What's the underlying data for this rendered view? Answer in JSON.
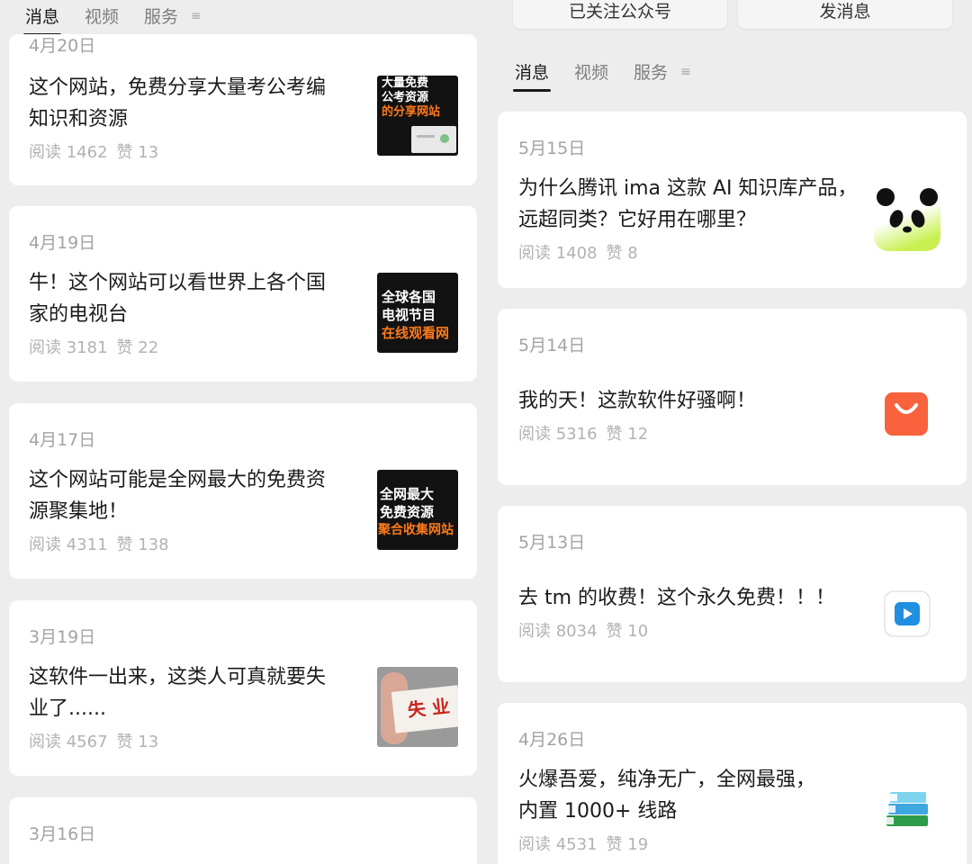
{
  "left": {
    "tabs": [
      {
        "label": "消息"
      },
      {
        "label": "视频"
      },
      {
        "label": "服务"
      }
    ],
    "tab_menu_symbol": "≡",
    "articles": [
      {
        "date": "4月20日",
        "title_lines": [
          "这个网站，免费分享大量考公考编",
          "知识和资源"
        ],
        "reads": "阅读 1462",
        "likes": "赞 13",
        "thumb_lines": [
          "大量免费",
          "公考资源",
          "的分享网站"
        ]
      },
      {
        "date": "4月19日",
        "title_lines": [
          "牛！这个网站可以看世界上各个国",
          "家的电视台"
        ],
        "reads": "阅读 3181",
        "likes": "赞 22",
        "thumb_lines": [
          "全球各国",
          "电视节目",
          "在线观看网"
        ]
      },
      {
        "date": "4月17日",
        "title_lines": [
          "这个网站可能是全网最大的免费资",
          "源聚集地！"
        ],
        "reads": "阅读 4311",
        "likes": "赞 138",
        "thumb_lines": [
          "全网最大",
          "免费资源",
          "聚合收集网站"
        ]
      },
      {
        "date": "3月19日",
        "title_lines": [
          "这软件一出来，这类人可真就要失",
          "业了......"
        ],
        "reads": "阅读 4567",
        "likes": "赞 13",
        "thumb_lines": [
          "失 业"
        ]
      },
      {
        "date": "3月16日"
      }
    ]
  },
  "right": {
    "top_buttons": [
      {
        "label": "已关注公众号"
      },
      {
        "label": "发消息"
      }
    ],
    "tabs": [
      {
        "label": "消息"
      },
      {
        "label": "视频"
      },
      {
        "label": "服务"
      }
    ],
    "tab_menu_symbol": "≡",
    "articles": [
      {
        "date": "5月15日",
        "title_lines": [
          "为什么腾讯 ima 这款 AI 知识库产品，",
          "远超同类？它好用在哪里？"
        ],
        "reads": "阅读 1408",
        "likes": "赞 8",
        "icon": "panda-icon"
      },
      {
        "date": "5月14日",
        "title_lines": [
          "我的天！这款软件好骚啊！"
        ],
        "reads": "阅读 5316",
        "likes": "赞 12",
        "icon": "shopping-bag-icon"
      },
      {
        "date": "5月13日",
        "title_lines": [
          "去 tm 的收费！这个永久免费！！！"
        ],
        "reads": "阅读 8034",
        "likes": "赞 10",
        "icon": "play-icon"
      },
      {
        "date": "4月26日",
        "title_lines": [
          "火爆吾爱，纯净无广，全网最强，",
          "内置 1000+ 线路"
        ],
        "reads": "阅读 4531",
        "likes": "赞 19",
        "icon": "books-icon"
      }
    ]
  },
  "colors": {
    "background": "#ededed",
    "card": "#ffffff",
    "text_primary": "#1b1b1b",
    "text_secondary": "#a3a3a3",
    "accent_orange": "#ff7a1a",
    "bag_orange": "#f8623c",
    "play_blue": "#1f8fe0"
  }
}
